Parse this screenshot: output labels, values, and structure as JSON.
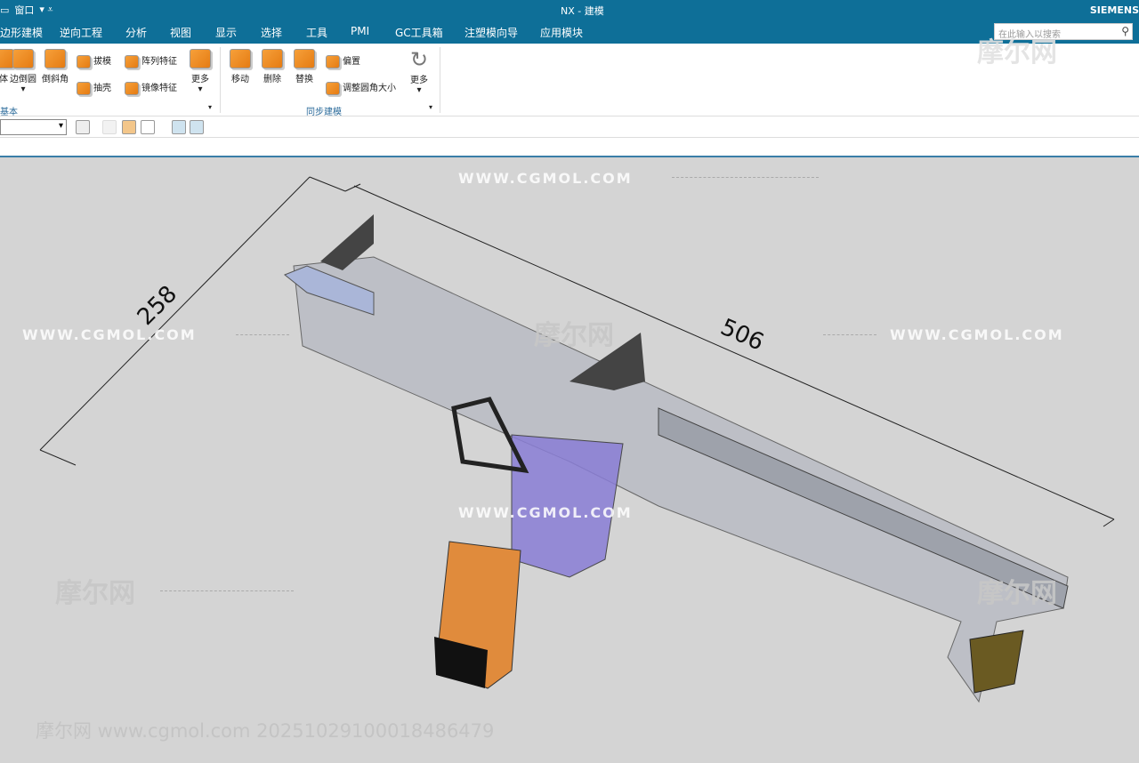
{
  "titlebar": {
    "window_menu": "窗口",
    "title": "NX - 建模",
    "brand": "SIEMENS"
  },
  "tabs": [
    "边形建模",
    "逆向工程",
    "分析",
    "视图",
    "显示",
    "选择",
    "工具",
    "PMI",
    "GC工具箱",
    "注塑模向导",
    "应用模块"
  ],
  "search": {
    "placeholder": "在此输入以搜索"
  },
  "ribbon": {
    "basic": {
      "label": "基本",
      "buttons": [
        "体",
        "边倒圆",
        "倒斜角"
      ],
      "small": [
        "拔模",
        "抽壳",
        "阵列特征",
        "镜像特征"
      ],
      "more": "更多"
    },
    "sync": {
      "label": "同步建模",
      "buttons": [
        "移动",
        "删除",
        "替换"
      ],
      "small": [
        "偏置",
        "调整圆角大小"
      ],
      "more": "更多"
    }
  },
  "model": {
    "dimensions": [
      "258",
      "506"
    ]
  },
  "watermarks": {
    "url": "WWW.CGMOL.COM",
    "cn": "摩尔网",
    "footer": "摩尔网 www.cgmol.com 20251029100018486479"
  },
  "colors": {
    "bar": "#0e6f98",
    "viewport": "#d4d4d4",
    "accent": "#e57b12"
  }
}
